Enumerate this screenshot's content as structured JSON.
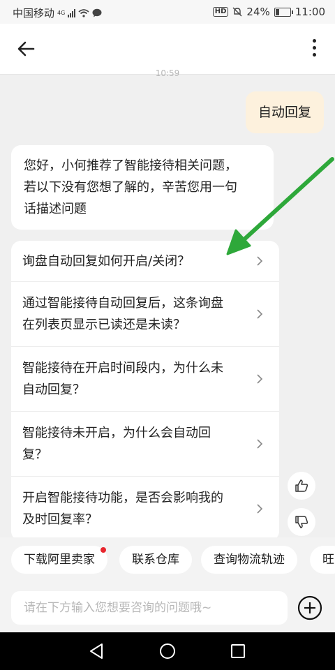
{
  "status_bar": {
    "carrier": "中国移动",
    "network": "4G",
    "hd": "HD",
    "battery": "24%",
    "battery_level": 0.24,
    "time": "11:00"
  },
  "header": {
    "back_icon": "arrow-left-icon",
    "more_icon": "more-vertical-icon"
  },
  "chat": {
    "timestamp_partial": "10:59",
    "user_message": "自动回复",
    "bot_intro_lines": [
      "您好，小何推荐了智能接待相关问题，",
      "若以下没有您想了解的，辛苦您用一句",
      "话描述问题"
    ],
    "questions": [
      {
        "lines": [
          "询盘自动回复如何开启/关闭？"
        ]
      },
      {
        "lines": [
          "通过智能接待自动回复后，这条询盘",
          "在列表页显示已读还是未读？"
        ]
      },
      {
        "lines": [
          "智能接待在开启时间段内，为什么未",
          "自动回复？"
        ]
      },
      {
        "lines": [
          "智能接待未开启，为什么会自动回",
          "复？"
        ]
      },
      {
        "lines": [
          "开启智能接待功能，是否会影响我的",
          "及时回复率？"
        ]
      }
    ],
    "feedback_icons": [
      "thumbs-up-icon",
      "thumbs-down-icon"
    ],
    "annotation_arrow_color": "#2ea83a"
  },
  "quick_actions": [
    {
      "label": "下载阿里卖家",
      "badge": true
    },
    {
      "label": "联系仓库",
      "badge": false
    },
    {
      "label": "查询物流轨迹",
      "badge": false
    },
    {
      "label": "旺",
      "badge": false
    }
  ],
  "input": {
    "placeholder": "请在下方输入您想要咨询的问题哦~",
    "plus_icon": "plus-circle-icon"
  },
  "navbar": {
    "icons": [
      "back-triangle-icon",
      "home-circle-icon",
      "recents-square-icon"
    ]
  },
  "colors": {
    "user_bubble": "#fdf1dd",
    "badge": "#e8262e",
    "annotation": "#2ea83a"
  }
}
